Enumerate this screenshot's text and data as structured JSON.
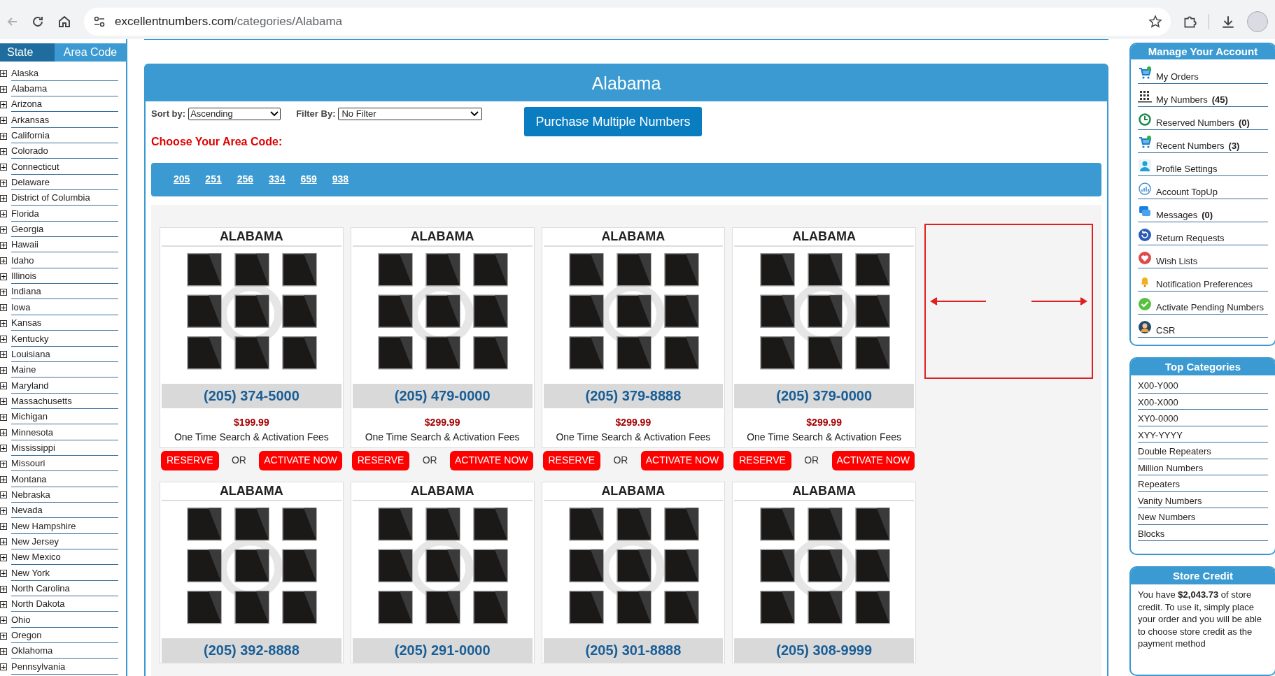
{
  "browser": {
    "url_host": "excellentnumbers.com",
    "url_path": "/categories/Alabama"
  },
  "sidebar": {
    "tabs": [
      {
        "label": "State",
        "selected": true
      },
      {
        "label": "Area Code",
        "selected": false
      }
    ],
    "states": [
      "Alaska",
      "Alabama",
      "Arizona",
      "Arkansas",
      "California",
      "Colorado",
      "Connecticut",
      "Delaware",
      "District of Columbia",
      "Florida",
      "Georgia",
      "Hawaii",
      "Idaho",
      "Illinois",
      "Indiana",
      "Iowa",
      "Kansas",
      "Kentucky",
      "Louisiana",
      "Maine",
      "Maryland",
      "Massachusetts",
      "Michigan",
      "Minnesota",
      "Mississippi",
      "Missouri",
      "Montana",
      "Nebraska",
      "Nevada",
      "New Hampshire",
      "New Jersey",
      "New Mexico",
      "New York",
      "North Carolina",
      "North Dakota",
      "Ohio",
      "Oregon",
      "Oklahoma",
      "Pennsylvania"
    ]
  },
  "main": {
    "title": "Alabama",
    "sort_label": "Sort by:",
    "sort_value": "Ascending",
    "filter_label": "Filter By:",
    "filter_value": "No Filter",
    "purchase_button": "Purchase Multiple Numbers",
    "choose_label": "Choose Your Area Code:",
    "area_codes": [
      "205",
      "251",
      "256",
      "334",
      "659",
      "938"
    ],
    "listings": [
      {
        "state": "ALABAMA",
        "number": "(205) 374-5000",
        "price": "$199.99",
        "fee_note": "One Time Search & Activation Fees",
        "reserve": "RESERVE",
        "or": "OR",
        "activate": "ACTIVATE NOW"
      },
      {
        "state": "ALABAMA",
        "number": "(205) 479-0000",
        "price": "$299.99",
        "fee_note": "One Time Search & Activation Fees",
        "reserve": "RESERVE",
        "or": "OR",
        "activate": "ACTIVATE NOW"
      },
      {
        "state": "ALABAMA",
        "number": "(205) 379-8888",
        "price": "$299.99",
        "fee_note": "One Time Search & Activation Fees",
        "reserve": "RESERVE",
        "or": "OR",
        "activate": "ACTIVATE NOW"
      },
      {
        "state": "ALABAMA",
        "number": "(205) 379-0000",
        "price": "$299.99",
        "fee_note": "One Time Search & Activation Fees",
        "reserve": "RESERVE",
        "or": "OR",
        "activate": "ACTIVATE NOW"
      },
      {
        "state": "ALABAMA",
        "number": "(205) 392-8888"
      },
      {
        "state": "ALABAMA",
        "number": "(205) 291-0000"
      },
      {
        "state": "ALABAMA",
        "number": "(205) 301-8888"
      },
      {
        "state": "ALABAMA",
        "number": "(205) 308-9999"
      }
    ]
  },
  "account": {
    "title": "Manage Your Account",
    "items": [
      {
        "kind": "cart",
        "label": "My Orders"
      },
      {
        "kind": "grid",
        "label": "My Numbers",
        "count": "(45)"
      },
      {
        "kind": "clock",
        "label": "Reserved Numbers",
        "count": "(0)"
      },
      {
        "kind": "cart",
        "label": "Recent Numbers",
        "count": "(3)"
      },
      {
        "kind": "user",
        "label": "Profile Settings"
      },
      {
        "kind": "chart",
        "label": "Account TopUp"
      },
      {
        "kind": "chat",
        "label": "Messages",
        "count": "(0)"
      },
      {
        "kind": "return",
        "label": "Return Requests"
      },
      {
        "kind": "heart",
        "label": "Wish Lists"
      },
      {
        "kind": "bell",
        "label": "Notification Preferences"
      },
      {
        "kind": "check",
        "label": "Activate Pending Numbers"
      },
      {
        "kind": "person",
        "label": "CSR"
      }
    ]
  },
  "categories": {
    "title": "Top Categories",
    "items": [
      "X00-Y000",
      "X00-X000",
      "XY0-0000",
      "XYY-YYYY",
      "Double Repeaters",
      "Million Numbers",
      "Repeaters",
      "Vanity Numbers",
      "New Numbers",
      "Blocks"
    ]
  },
  "store_credit": {
    "title": "Store Credit",
    "text": "You have **$2,043.73** of store credit. To use it, simply place your order and you will be able to choose store credit as the payment method"
  }
}
